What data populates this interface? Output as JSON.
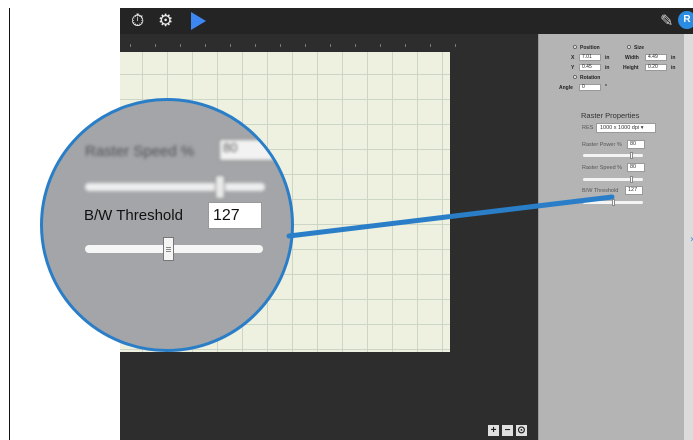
{
  "toolbar": {
    "icons": [
      "stopwatch-icon",
      "gear-icon",
      "play-icon",
      "pencil-icon",
      "logo-icon"
    ],
    "logo_text": "R"
  },
  "panel": {
    "position_label": "Position",
    "size_label": "Size",
    "x_label": "X",
    "x_value": "7.01",
    "x_unit": "in",
    "y_label": "Y",
    "y_value": "0.45",
    "y_unit": "in",
    "width_label": "Width",
    "width_value": "4.49",
    "width_unit": "in",
    "height_label": "Height",
    "height_value": "0.20",
    "height_unit": "in",
    "rotation_label": "Rotation",
    "angle_label": "Angle",
    "angle_value": "0",
    "angle_unit": "°"
  },
  "raster": {
    "title": "Raster Properties",
    "res_label": "RES",
    "res_value": "1000 x 1000 dpi",
    "power_label": "Raster Power %",
    "power_value": "80",
    "speed_label": "Raster Speed %",
    "speed_value": "80",
    "threshold_label": "B/W Threshold",
    "threshold_value": "127"
  },
  "magnifier": {
    "speed_label": "Raster Speed %",
    "speed_value": "80",
    "threshold_label": "B/W Threshold",
    "threshold_value": "127"
  },
  "zoom": {
    "plus": "+",
    "minus": "−",
    "fit": "⊙"
  },
  "colors": {
    "accent": "#2a7ec8",
    "toolbar_bg": "#242424",
    "canvas_bg": "#eef0e0",
    "panel_bg": "#b4b4b4",
    "play": "#3d87f5"
  }
}
